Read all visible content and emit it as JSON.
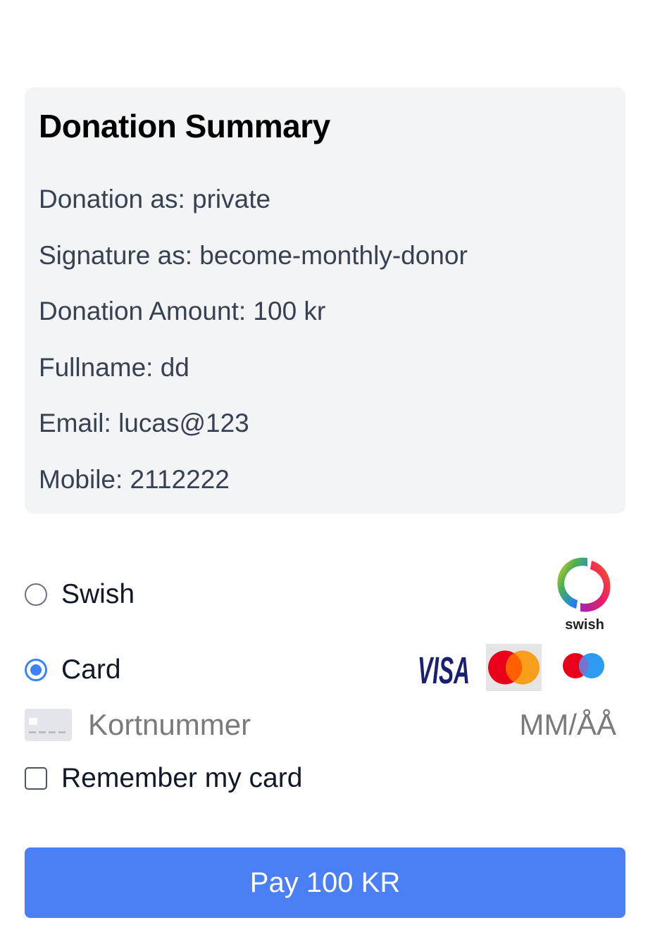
{
  "summary": {
    "title": "Donation Summary",
    "lines": [
      "Donation as: private",
      "Signature as: become-monthly-donor",
      "Donation Amount: 100 kr",
      "Fullname: dd",
      "Email: lucas@123",
      "Mobile: 2112222"
    ]
  },
  "payment": {
    "swish_label": "Swish",
    "swish_selected": false,
    "swish_logo_text": "swish",
    "card_label": "Card",
    "card_selected": true,
    "visa_text": "VISA",
    "card_number_placeholder": "Kortnummer",
    "expiry_placeholder": "MM/ÅÅ",
    "remember_label": "Remember my card",
    "remember_checked": false
  },
  "pay_button_label": "Pay 100 KR",
  "colors": {
    "accent": "#3b82f6",
    "button": "#4a7ff5",
    "summary_bg": "#f3f4f6"
  }
}
